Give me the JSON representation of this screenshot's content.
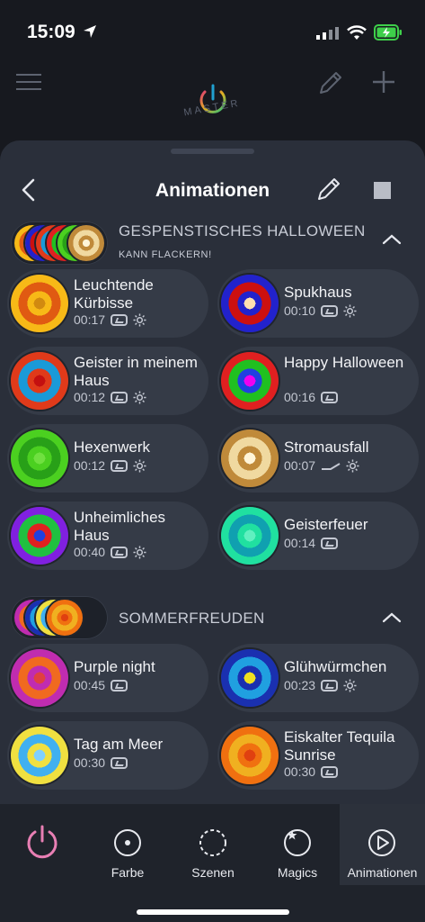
{
  "status": {
    "time": "15:09"
  },
  "topnav": {
    "logo_text": "MASTER"
  },
  "sheet": {
    "title": "Animationen"
  },
  "groups": [
    {
      "name": "GESPENSTISCHES HALLOWEEN",
      "subtitle": "KANN FLACKERN!",
      "items": [
        {
          "name": "Leuchtende Kürbisse",
          "duration": "00:17",
          "icons": [
            "loop-icon",
            "brightness-icon"
          ],
          "colors": [
            "#f7b917",
            "#e05a12",
            "#f7b917",
            "#d18a10"
          ]
        },
        {
          "name": "Spukhaus",
          "duration": "00:10",
          "icons": [
            "loop-icon",
            "brightness-icon"
          ],
          "colors": [
            "#2222cc",
            "#cc1010",
            "#2222cc",
            "#ffe0b0"
          ]
        },
        {
          "name": "Geister in meinem Haus",
          "duration": "00:12",
          "icons": [
            "loop-icon",
            "brightness-icon"
          ],
          "colors": [
            "#e03a1a",
            "#1a9ad8",
            "#e03a1a",
            "#c41010"
          ]
        },
        {
          "name": "Happy Halloween",
          "duration": "00:16",
          "icons": [
            "loop-icon"
          ],
          "colors": [
            "#e02020",
            "#20c020",
            "#2040e0",
            "#f000f0"
          ]
        },
        {
          "name": "Hexenwerk",
          "duration": "00:12",
          "icons": [
            "loop-icon",
            "brightness-icon"
          ],
          "colors": [
            "#4bd020",
            "#28a018",
            "#4bd020",
            "#70e040"
          ]
        },
        {
          "name": "Stromausfall",
          "duration": "00:07",
          "icons": [
            "fade-icon",
            "brightness-icon"
          ],
          "colors": [
            "#c08a3a",
            "#f0d9a0",
            "#c08a3a",
            "#fff4d8"
          ]
        },
        {
          "name": "Unheimliches Haus",
          "duration": "00:40",
          "icons": [
            "loop-icon",
            "brightness-icon"
          ],
          "colors": [
            "#8020e0",
            "#20c040",
            "#e02020",
            "#2040e0"
          ]
        },
        {
          "name": "Geisterfeuer",
          "duration": "00:14",
          "icons": [
            "loop-icon"
          ],
          "colors": [
            "#20e0a0",
            "#10a0b0",
            "#20e0a0",
            "#60f0c0"
          ]
        }
      ]
    },
    {
      "name": "SOMMERFREUDEN",
      "subtitle": "",
      "items": [
        {
          "name": "Purple night",
          "duration": "00:45",
          "icons": [
            "loop-icon"
          ],
          "colors": [
            "#c02cb0",
            "#f06a20",
            "#c02cb0",
            "#e04040"
          ]
        },
        {
          "name": "Glühwürmchen",
          "duration": "00:23",
          "icons": [
            "loop-icon",
            "brightness-icon"
          ],
          "colors": [
            "#1a30b0",
            "#20a0e0",
            "#1a30b0",
            "#f0e020"
          ]
        },
        {
          "name": "Tag am Meer",
          "duration": "00:30",
          "icons": [
            "loop-icon"
          ],
          "colors": [
            "#f0e040",
            "#40b0f0",
            "#f0e040",
            "#80d0ff"
          ]
        },
        {
          "name": "Eiskalter Tequila Sunrise",
          "duration": "00:30",
          "icons": [
            "loop-icon"
          ],
          "colors": [
            "#f07010",
            "#f0b020",
            "#f07010",
            "#e04010"
          ]
        }
      ]
    }
  ],
  "tabs": [
    {
      "label": "",
      "icon": "power-icon",
      "active": false
    },
    {
      "label": "Farbe",
      "icon": "color-icon",
      "active": false
    },
    {
      "label": "Szenen",
      "icon": "scenes-icon",
      "active": false
    },
    {
      "label": "Magics",
      "icon": "magics-icon",
      "active": false
    },
    {
      "label": "Animationen",
      "icon": "play-icon",
      "active": true
    }
  ],
  "colors": {
    "accent_pink": "#e87fb4",
    "sheet_bg": "#2a2f3a",
    "card_bg": "#353b47"
  }
}
